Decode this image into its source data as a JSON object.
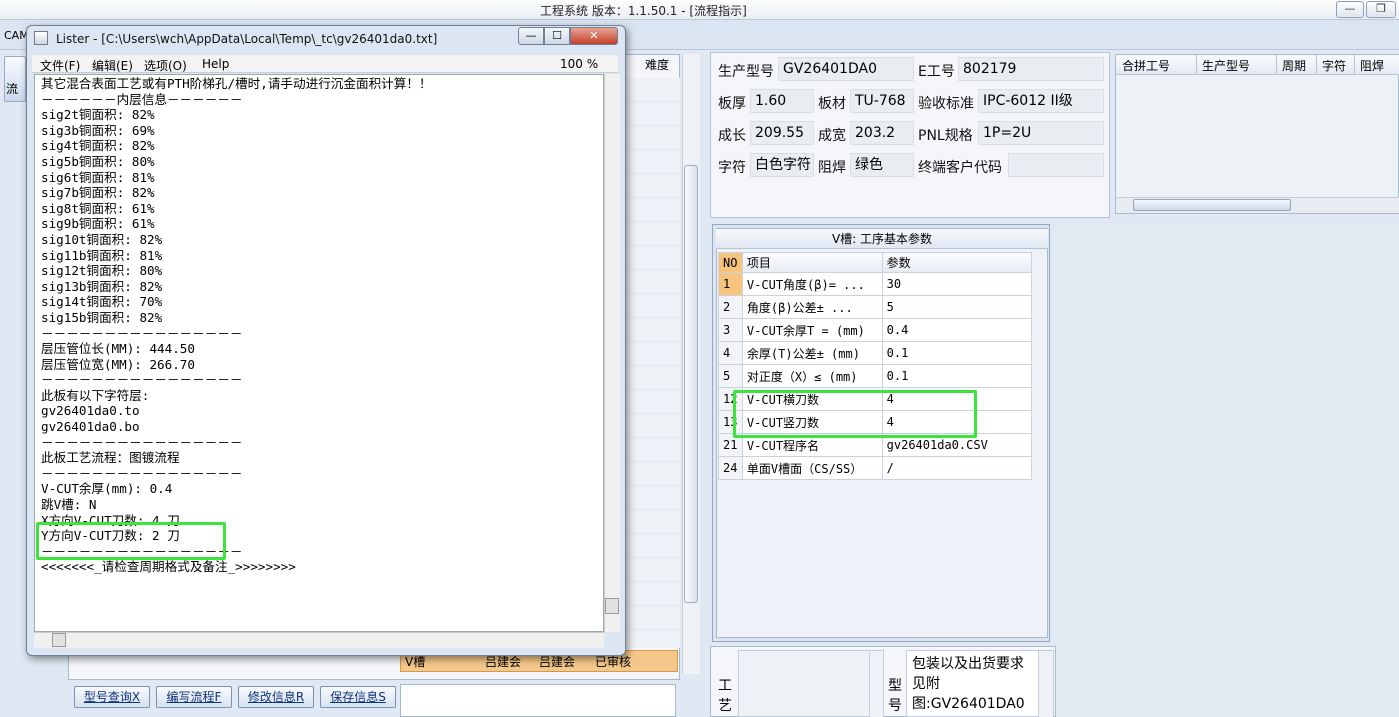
{
  "app": {
    "title": "工程系统   版本：1.1.50.1 - [流程指示]",
    "min": "—",
    "restore": "❐",
    "cam": "CAM",
    "side_tab": "流"
  },
  "bg_list": {
    "col_nandu": "难度",
    "vgroove_row": {
      "name": "V槽",
      "person1": "吕建会",
      "person2": "吕建会",
      "status": "已审核"
    }
  },
  "buttons": {
    "query": "型号查询X",
    "edit_flow": "编写流程F",
    "modify": "修改信息R",
    "save": "保存信息S"
  },
  "lister": {
    "title": "Lister - [C:\\Users\\wch\\AppData\\Local\\Temp\\_tc\\gv26401da0.txt]",
    "min": "—",
    "max": "☐",
    "close": "✕",
    "menu": [
      "文件(F)",
      "编辑(E)",
      "选项(O)",
      "Help"
    ],
    "zoom": "100 %",
    "lines": [
      "其它混合表面工艺或有PTH阶梯孔/槽时,请手动进行沉金面积计算！！",
      "－－－－－－内层信息－－－－－－",
      "sig2t铜面积: 82%",
      "sig3b铜面积: 69%",
      "sig4t铜面积: 82%",
      "sig5b铜面积: 80%",
      "sig6t铜面积: 81%",
      "sig7b铜面积: 82%",
      "sig8t铜面积: 61%",
      "sig9b铜面积: 61%",
      "sig10t铜面积: 82%",
      "sig11b铜面积: 81%",
      "sig12t铜面积: 80%",
      "sig13b铜面积: 82%",
      "sig14t铜面积: 70%",
      "sig15b铜面积: 82%",
      "－－－－－－－－－－－－－－－－",
      "层压管位长(MM): 444.50",
      "层压管位宽(MM): 266.70",
      "－－－－－－－－－－－－－－－－",
      "此板有以下字符层:",
      "gv26401da0.to",
      "gv26401da0.bo",
      "－－－－－－－－－－－－－－－－",
      "此板工艺流程：图镀流程",
      "－－－－－－－－－－－－－－－－",
      "V-CUT余厚(mm): 0.4",
      "跳V槽: N",
      "X方向V-CUT刀数: 4 刀",
      "Y方向V-CUT刀数: 2 刀",
      "－－－－－－－－－－－－－－－－",
      "<<<<<<<_请检查周期格式及备注_>>>>>>>>"
    ]
  },
  "info": {
    "model_label": "生产型号",
    "model": "GV26401DA0",
    "e_label": "E工号",
    "e_no": "802179",
    "thick_label": "板厚",
    "thick": "1.60",
    "mat_label": "板材",
    "mat": "TU-768",
    "std_label": "验收标准",
    "std": "IPC-6012 II级",
    "len_label": "成长",
    "len": "209.55",
    "wid_label": "成宽",
    "wid": "203.2",
    "pnl_label": "PNL规格",
    "pnl": "1P=2U",
    "char_label": "字符",
    "char": "白色字符",
    "mask_label": "阻焊",
    "mask": "绿色",
    "cust_label": "终端客户代码",
    "cust": ""
  },
  "merge_grid": {
    "headers": [
      "合拼工号",
      "生产型号",
      "周期",
      "字符",
      "阻焊"
    ]
  },
  "vgroove": {
    "title": "V槽: 工序基本参数",
    "headers": [
      "NO",
      "项目",
      "参数"
    ],
    "rows": [
      {
        "no": "1",
        "item": "V-CUT角度(β)=  ...",
        "val": "30"
      },
      {
        "no": "2",
        "item": "角度(β)公差±  ...",
        "val": "5"
      },
      {
        "no": "3",
        "item": "V-CUT余厚T =  (mm)",
        "val": "0.4"
      },
      {
        "no": "4",
        "item": "余厚(T)公差±  (mm)",
        "val": "0.1"
      },
      {
        "no": "5",
        "item": "对正度（X）≤ (mm)",
        "val": "0.1"
      },
      {
        "no": "12",
        "item": "V-CUT横刀数",
        "val": "4"
      },
      {
        "no": "13",
        "item": "V-CUT竖刀数",
        "val": "4"
      },
      {
        "no": "21",
        "item": "V-CUT程序名",
        "val": "gv26401da0.CSV"
      },
      {
        "no": "24",
        "item": "单面V槽面（CS/SS）",
        "val": "/"
      }
    ]
  },
  "bottom_right": {
    "gongyi": "工艺",
    "xinghao": "型号",
    "packing": "包装以及出货要求见附图:GV26401DA0"
  }
}
